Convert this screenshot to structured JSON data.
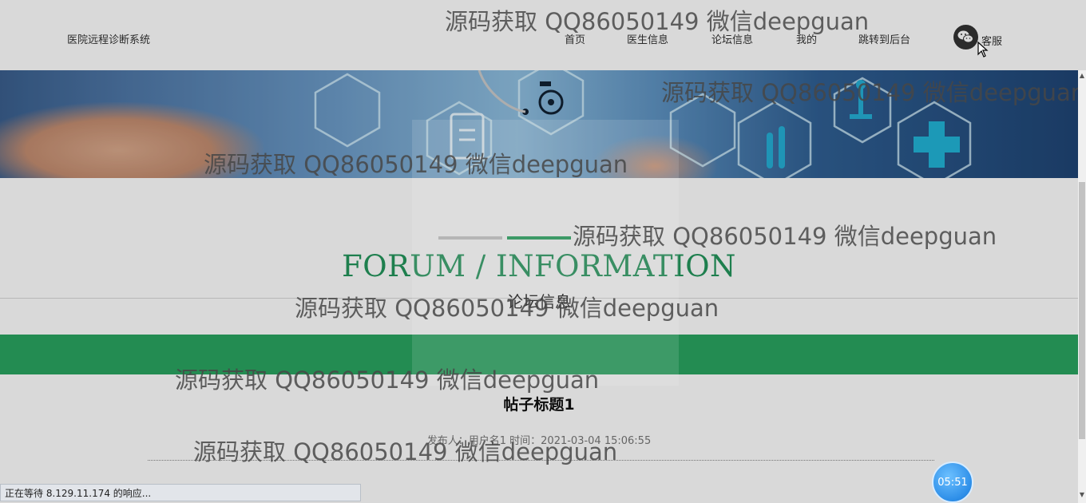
{
  "header": {
    "logo_text": "医院远程诊断系统",
    "nav": [
      "首页",
      "医生信息",
      "论坛信息",
      "我的",
      "跳转到后台"
    ],
    "service_label": "客服"
  },
  "section": {
    "title_en": "FORUM / INFORMATION",
    "title_cn": "论坛信息"
  },
  "post": {
    "title": "帖子标题1",
    "meta": "发布人：用户名1 时间：2021-03-04 15:06:55"
  },
  "watermark_text": "源码获取 QQ86050149 微信deepguan",
  "status_text": "正在等待 8.129.11.174 的响应...",
  "timer_text": "05:51",
  "colors": {
    "accent_green": "#2aa561",
    "title_green": "#24965c",
    "banner_blue": "#4f78a8"
  },
  "icons": [
    "wechat-icon",
    "cursor-icon",
    "wheelchair-icon",
    "test-tubes-icon",
    "medical-cross-icon",
    "stethoscope-icon"
  ]
}
